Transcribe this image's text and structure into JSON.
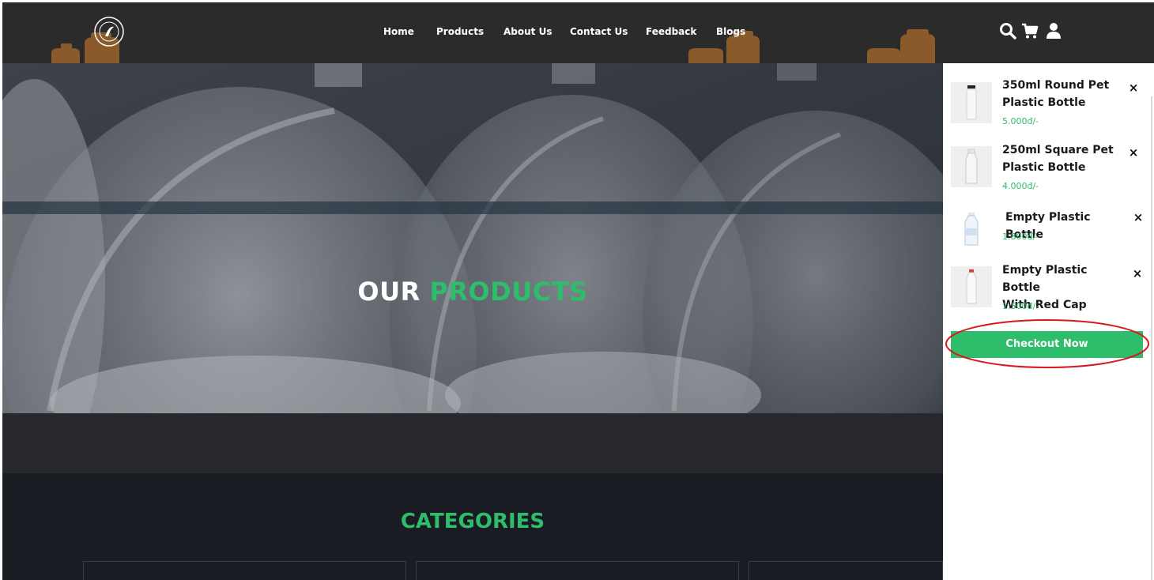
{
  "nav": {
    "items": [
      {
        "label": "Home"
      },
      {
        "label": "Products"
      },
      {
        "label": "About Us"
      },
      {
        "label": "Contact Us"
      },
      {
        "label": "Feedback"
      },
      {
        "label": "Blogs"
      }
    ]
  },
  "header_icons": [
    "search-icon",
    "cart-icon",
    "user-icon"
  ],
  "hero": {
    "title_white": "OUR",
    "title_green": "PRODUCTS"
  },
  "categories": {
    "title": "CATEGORIES"
  },
  "cart": {
    "items": [
      {
        "name_line1": "350ml Round Pet",
        "name_line2": "Plastic Bottle",
        "price": "5.000đ/-",
        "remove": "×"
      },
      {
        "name_line1": "250ml Square Pet",
        "name_line2": "Plastic Bottle",
        "price": "4.000đ/-",
        "remove": "×"
      },
      {
        "name_line1": "Empty Plastic Bottle",
        "name_line2": "",
        "price": "1.800đ/-",
        "remove": "×"
      },
      {
        "name_line1": "Empty Plastic Bottle",
        "name_line2": "With Red Cap",
        "price": "1.500đ/-",
        "remove": "×"
      }
    ],
    "checkout_label": "Checkout Now"
  },
  "colors": {
    "accent_green": "#2ebd6b",
    "header_bg": "#2b2b2c",
    "dark_section": "#1a1c24",
    "highlight_ring": "#d71920"
  }
}
